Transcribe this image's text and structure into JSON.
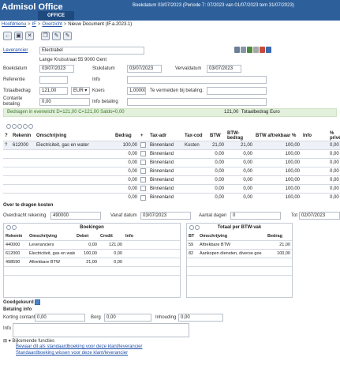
{
  "app": {
    "title": "Admisol Office",
    "tab_label": "OFFICE",
    "header_info": "Boekdatum 03/07/2023 (Periode 7: 07/2023 van 01/07/2023 tem 31/07/2023)"
  },
  "breadcrumb": [
    "Hoofdmenu",
    "IF",
    "Overzicht",
    "Nieuw Document (IF.a.2023.1)"
  ],
  "form": {
    "leverancier_label": "Leverancier",
    "leverancier_value": "Electrabel",
    "address": "Lange Kruisstraat 55 9000 Gent",
    "boekdatum_label": "Boekdatum",
    "boekdatum_value": "03/07/2023",
    "stukdatum_label": "Stukdatum",
    "stukdatum_value": "03/07/2023",
    "vervaldatum_label": "Vervaldatum",
    "vervaldatum_value": "03/07/2023",
    "referentie_label": "Referentie",
    "referentie_value": "",
    "info_label": "Info",
    "info_value": "",
    "totaalbedrag_label": "Totaalbedrag",
    "totaalbedrag_value": "121,00",
    "currency": "EUR",
    "koers_label": "Koers",
    "koers_value": "1,00000",
    "vermelden_label": "Te vermelden bij betaling:",
    "vermelden_value": "",
    "contante_label": "Contante betaling",
    "contante_value": "0,00",
    "info_betaling_label": "Info betaling",
    "info_betaling_value": ""
  },
  "balance": {
    "message": "Bedragen in evenwicht D=121,00 C=121,00 Saldo=0,00",
    "total_value": "121,00",
    "total_label": "Totaalbedrag Euro"
  },
  "main_table": {
    "headers": [
      "?",
      "Rekenin",
      "Omschrijving",
      "Bedrag",
      "+",
      "Tax-adr",
      "Tax-cod",
      "BTW",
      "BTW-bedrag",
      "BTW aftrekbaar %",
      "Info",
      "% privé"
    ],
    "rows": [
      {
        "q": "?",
        "rek": "612000",
        "oms": "Electriciteit, gas en water",
        "bedrag": "100,00",
        "tax_adr": "Binnenland",
        "tax_cod": "Kosten",
        "btw": "21,00",
        "btw_bedrag": "21,00",
        "aftrek": "100,00",
        "info": "",
        "prive": "0,00"
      },
      {
        "q": "",
        "rek": "",
        "oms": "",
        "bedrag": "0,00",
        "tax_adr": "Binnenland",
        "tax_cod": "",
        "btw": "0,00",
        "btw_bedrag": "0,00",
        "aftrek": "100,00",
        "info": "",
        "prive": "0,00"
      },
      {
        "q": "",
        "rek": "",
        "oms": "",
        "bedrag": "0,00",
        "tax_adr": "Binnenland",
        "tax_cod": "",
        "btw": "0,00",
        "btw_bedrag": "0,00",
        "aftrek": "100,00",
        "info": "",
        "prive": "0,00"
      },
      {
        "q": "",
        "rek": "",
        "oms": "",
        "bedrag": "0,00",
        "tax_adr": "Binnenland",
        "tax_cod": "",
        "btw": "0,00",
        "btw_bedrag": "0,00",
        "aftrek": "100,00",
        "info": "",
        "prive": "0,00"
      },
      {
        "q": "",
        "rek": "",
        "oms": "",
        "bedrag": "0,00",
        "tax_adr": "Binnenland",
        "tax_cod": "",
        "btw": "0,00",
        "btw_bedrag": "0,00",
        "aftrek": "100,00",
        "info": "",
        "prive": "0,00"
      },
      {
        "q": "",
        "rek": "",
        "oms": "",
        "bedrag": "0,00",
        "tax_adr": "Binnenland",
        "tax_cod": "",
        "btw": "0,00",
        "btw_bedrag": "0,00",
        "aftrek": "100,00",
        "info": "",
        "prive": "0,00"
      },
      {
        "q": "",
        "rek": "",
        "oms": "",
        "bedrag": "0,00",
        "tax_adr": "Binnenland",
        "tax_cod": "",
        "btw": "0,00",
        "btw_bedrag": "0,00",
        "aftrek": "100,00",
        "info": "",
        "prive": "0,00"
      }
    ]
  },
  "transfer": {
    "title": "Over te dragen kosten",
    "rekening_label": "Overdracht rekening",
    "rekening_value": "490000",
    "vanaf_label": "Vanaf datum",
    "vanaf_value": "03/07/2023",
    "dagen_label": "Aantal dagen",
    "dagen_value": "0",
    "tot_label": "Tot",
    "tot_value": "02/07/2023"
  },
  "boekingen": {
    "title": "Boekingen",
    "headers": [
      "Rekenin",
      "Omschrijving",
      "Debet",
      "Credit",
      "Info"
    ],
    "rows": [
      {
        "rek": "440000",
        "oms": "Leveranciers",
        "debet": "0,00",
        "credit": "121,00",
        "info": ""
      },
      {
        "rek": "612000",
        "oms": "Electriciteit, gas en wate",
        "debet": "100,00",
        "credit": "0,00",
        "info": ""
      },
      {
        "rek": "498590",
        "oms": "Aftrekbare BTW",
        "debet": "21,00",
        "credit": "0,00",
        "info": ""
      }
    ]
  },
  "btw_vak": {
    "title": "Totaal per BTW-vak",
    "headers": [
      "BT",
      "Omschrijving",
      "Bedrag"
    ],
    "rows": [
      {
        "bt": "59",
        "oms": "Aftrekbare BTW",
        "bedrag": "21,00"
      },
      {
        "bt": "82",
        "oms": "Aankopen diensten, diverse goe",
        "bedrag": "100,00"
      }
    ]
  },
  "footer": {
    "goedgekeurd_label": "Goedgekeurd",
    "betaling_info_title": "Betaling info",
    "korting_label": "Korting contant",
    "korting_value": "0,00",
    "borg_label": "Borg",
    "borg_value": "0,00",
    "inhouding_label": "Inhouding",
    "inhouding_value": "0,00",
    "info_label": "Info",
    "bij_title": "Bijkomende functies",
    "bij_links": [
      "Bewaar dit als standaardboeking voor deze klant/leverancier",
      "Standaardboeking wissen voor deze klant/leverancier"
    ]
  },
  "colors": {
    "header_blue": "#2d5f9a",
    "tab_blue": "#1e4a80",
    "link_blue": "#1f4fa8",
    "balance_green": "#3a7a2a",
    "balance_bg": "#e3f0dc"
  }
}
